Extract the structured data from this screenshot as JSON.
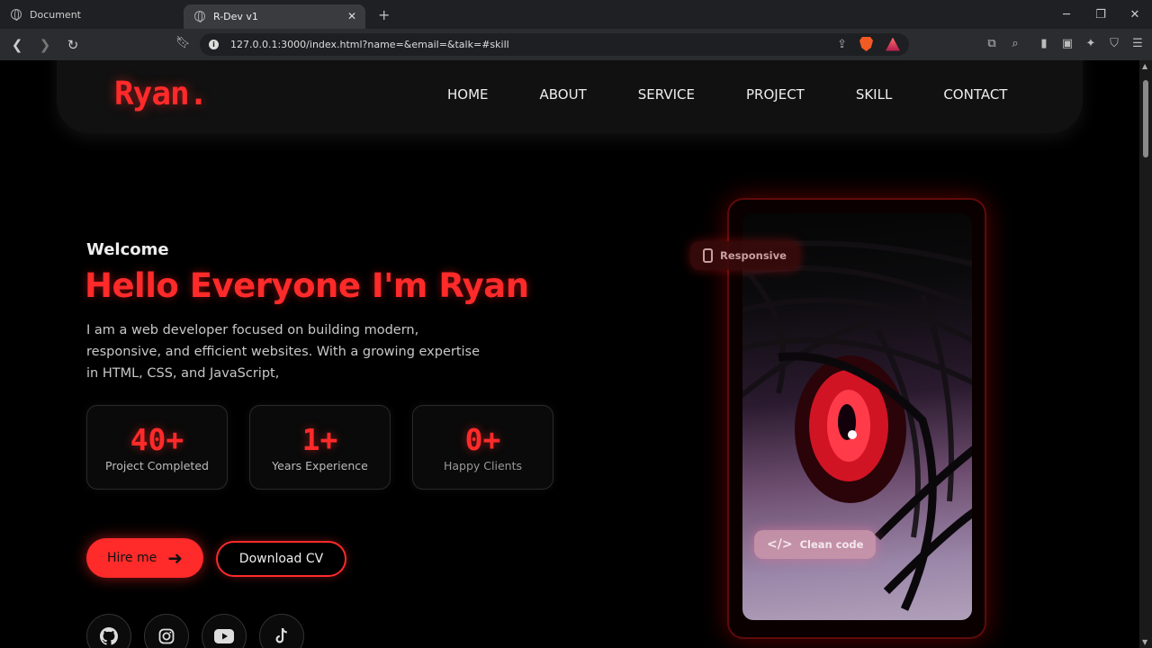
{
  "browser": {
    "tabs": [
      {
        "title": "Document",
        "active": false
      },
      {
        "title": "R-Dev v1",
        "active": true
      }
    ],
    "url": "127.0.0.1:3000/index.html?name=&email=&talk=#skill",
    "rewards_badge": "1"
  },
  "site": {
    "logo": "Ryan.",
    "nav": [
      "HOME",
      "ABOUT",
      "SERVICE",
      "PROJECT",
      "SKILL",
      "CONTACT"
    ],
    "welcome": "Welcome",
    "headline": "Hello Everyone I'm Ryan",
    "description": "I am a web developer focused on building modern, responsive, and efficient websites. With a growing expertise in HTML, CSS, and JavaScript,",
    "stats": [
      {
        "value": "40+",
        "label": "Project Completed"
      },
      {
        "value": "1+",
        "label": "Years Experience"
      },
      {
        "value": "0+",
        "label": "Happy Clients"
      }
    ],
    "buttons": {
      "hire": "Hire me",
      "cv": "Download CV"
    },
    "socials": [
      "github-icon",
      "instagram-icon",
      "youtube-icon",
      "tiktok-icon"
    ],
    "card_chips": {
      "responsive": "Responsive",
      "clean_code": "Clean code"
    }
  },
  "colors": {
    "accent": "#ff2a2a",
    "background": "#000000",
    "navbar": "#111111"
  }
}
